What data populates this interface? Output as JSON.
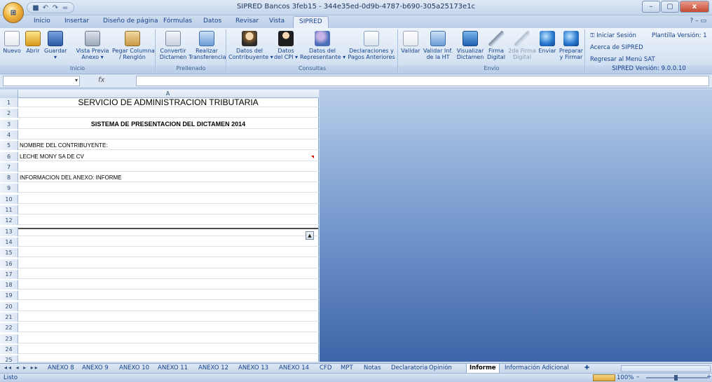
{
  "window": {
    "title": "SIPRED Bancos 3feb15 - 344e35ed-0d9b-4787-b690-305a25173e1c",
    "minimize": "–",
    "maximize": "▢",
    "close": "x"
  },
  "quick_access": {
    "save": "■",
    "undo": "↶",
    "redo": "↷",
    "more": "="
  },
  "ribbon_tabs": [
    "Inicio",
    "Insertar",
    "Diseño de página",
    "Fórmulas",
    "Datos",
    "Revisar",
    "Vista",
    "SIPRED"
  ],
  "active_tab": "SIPRED",
  "help": "? – ▭",
  "groups": {
    "inicio": {
      "label": "Inicio",
      "buttons": [
        {
          "label": "Nuevo",
          "icon": "new-document-icon"
        },
        {
          "label": "Abrir",
          "icon": "open-folder-icon"
        },
        {
          "label": "Guardar",
          "sub": "▾",
          "icon": "save-disk-icon"
        },
        {
          "label": "Vista Previa",
          "sub": "Anexo ▾",
          "icon": "print-preview-icon"
        },
        {
          "label": "Pegar Columna",
          "sub": "/ Renglón",
          "icon": "paste-icon"
        }
      ]
    },
    "prellenado": {
      "label": "Prellenado",
      "buttons": [
        {
          "label": "Convertir",
          "sub": "Dictamen",
          "icon": "convert-pen-icon"
        },
        {
          "label": "Realizar",
          "sub": "Transferencia",
          "icon": "transfer-grid-icon"
        }
      ]
    },
    "consultas": {
      "label": "Consultas",
      "buttons": [
        {
          "label": "Datos del",
          "sub": "Contribuyente ▾",
          "icon": "taxpayer-icon"
        },
        {
          "label": "Datos",
          "sub": "del CPI ▾",
          "icon": "accountant-icon"
        },
        {
          "label": "Datos del",
          "sub": "Representante ▾",
          "icon": "representative-icon"
        },
        {
          "label": "Declaraciones y",
          "sub": "Pagos Anteriores",
          "icon": "declarations-icon"
        }
      ]
    },
    "envio": {
      "label": "Envío",
      "buttons": [
        {
          "label": "Validar",
          "icon": "validate-check-icon"
        },
        {
          "label": "Validar Inf.",
          "sub": "de la HT",
          "icon": "validate-ht-icon"
        },
        {
          "label": "Visualizar",
          "sub": "Dictamen",
          "icon": "monitor-icon"
        },
        {
          "label": "Firma",
          "sub": "Digital",
          "icon": "digital-signature-icon"
        },
        {
          "label": "2da Firma",
          "sub": "Digital",
          "icon": "second-signature-icon"
        },
        {
          "label": "Enviar",
          "icon": "send-globe-icon"
        },
        {
          "label": "Preparar",
          "sub": "y Firmar",
          "icon": "prepare-globe-icon"
        }
      ]
    },
    "sipred": {
      "label": "SIPRED Versión: 9.0.0.10",
      "iniciar": "Iniciar Sesión",
      "plantilla": "Plantilla Versión: 1",
      "acerca": "Acerca de SIPRED",
      "regresar": "Regresar al Menú SAT"
    }
  },
  "formula_bar": {
    "name_value": "",
    "fx": "fx",
    "formula": ""
  },
  "sheet": {
    "column_header": "A",
    "rows": [
      {
        "n": "1",
        "text": "SERVICIO DE ADMINISTRACION TRIBUTARIA",
        "style": "big center"
      },
      {
        "n": "2",
        "text": "",
        "style": ""
      },
      {
        "n": "3",
        "text": "SISTEMA DE PRESENTACION DEL DICTAMEN 2014",
        "style": "bold center"
      },
      {
        "n": "4",
        "text": "",
        "style": ""
      },
      {
        "n": "5",
        "text": "NOMBRE DEL CONTRIBUYENTE:",
        "style": ""
      },
      {
        "n": "6",
        "text": "LECHE MONY SA DE CV",
        "style": ""
      },
      {
        "n": "7",
        "text": "",
        "style": ""
      },
      {
        "n": "8",
        "text": "INFORMACION DEL ANEXO: INFORME",
        "style": ""
      },
      {
        "n": "9",
        "text": "",
        "style": ""
      },
      {
        "n": "10",
        "text": "",
        "style": ""
      },
      {
        "n": "11",
        "text": "",
        "style": ""
      },
      {
        "n": "12",
        "text": "",
        "style": ""
      },
      {
        "n": "13",
        "text": "",
        "style": ""
      },
      {
        "n": "14",
        "text": "",
        "style": ""
      },
      {
        "n": "15",
        "text": "",
        "style": ""
      },
      {
        "n": "16",
        "text": "",
        "style": ""
      },
      {
        "n": "17",
        "text": "",
        "style": ""
      },
      {
        "n": "18",
        "text": "",
        "style": ""
      },
      {
        "n": "19",
        "text": "",
        "style": ""
      },
      {
        "n": "20",
        "text": "",
        "style": ""
      },
      {
        "n": "21",
        "text": "",
        "style": ""
      },
      {
        "n": "22",
        "text": "",
        "style": ""
      },
      {
        "n": "23",
        "text": "",
        "style": ""
      },
      {
        "n": "24",
        "text": "",
        "style": ""
      },
      {
        "n": "25",
        "text": "",
        "style": ""
      }
    ]
  },
  "sheet_tabs": [
    "ANEXO 8",
    "ANEXO 9",
    "ANEXO 10",
    "ANEXO 11",
    "ANEXO 12",
    "ANEXO 13",
    "ANEXO 14",
    "CFD",
    "MPT",
    "Notas",
    "Declaratoria",
    "Opinión",
    "Informe",
    "Información Adicional"
  ],
  "active_sheet": "Informe",
  "tab_nav": "◂◂ ◂ ▸ ▸▸",
  "status": {
    "text": "Listo",
    "zoom": "100%",
    "zoom_out": "–",
    "zoom_in": "+"
  }
}
